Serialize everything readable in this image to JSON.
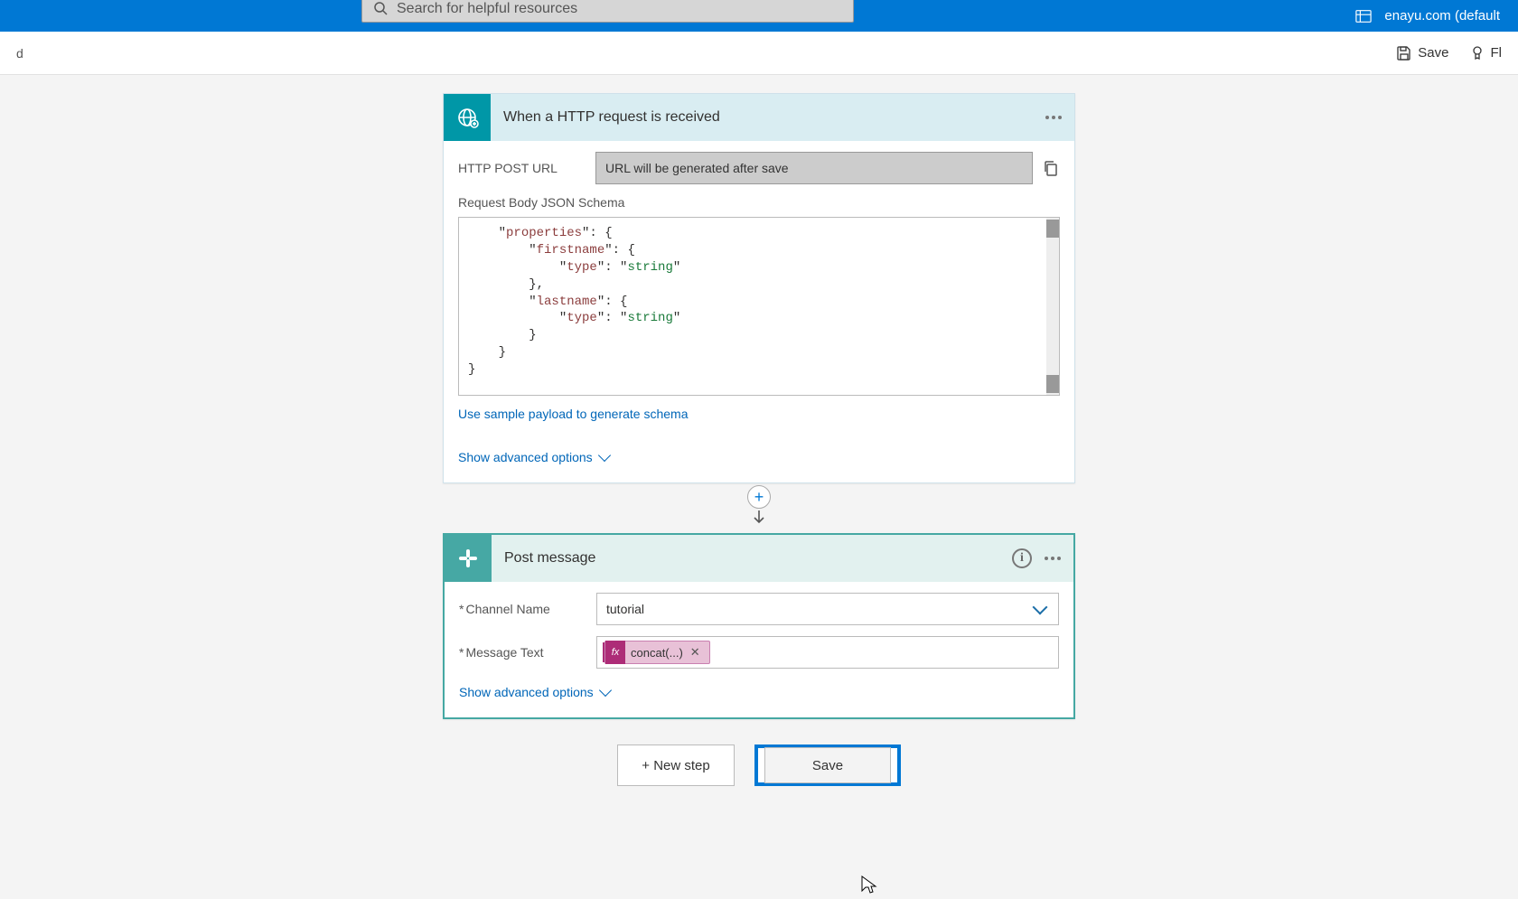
{
  "topbar": {
    "search_placeholder": "Search for helpful resources",
    "tenant": "enayu.com (default"
  },
  "commandbar": {
    "left_frag": "d",
    "save": "Save",
    "flow": "Fl"
  },
  "trigger": {
    "title": "When a HTTP request is received",
    "url_label": "HTTP POST URL",
    "url_value": "URL will be generated after save",
    "schema_label": "Request Body JSON Schema",
    "sample_link": "Use sample payload to generate schema",
    "advanced": "Show advanced options",
    "schema_lines": {
      "l1a": "    \"",
      "l1k": "properties",
      "l1b": "\": {",
      "l2a": "        \"",
      "l2k": "firstname",
      "l2b": "\": {",
      "l3a": "            \"",
      "l3k": "type",
      "l3b": "\": \"",
      "l3s": "string",
      "l3c": "\"",
      "l4": "        },",
      "l5a": "        \"",
      "l5k": "lastname",
      "l5b": "\": {",
      "l6a": "            \"",
      "l6k": "type",
      "l6b": "\": \"",
      "l6s": "string",
      "l6c": "\"",
      "l7": "        }",
      "l8": "    }",
      "l9": "}"
    }
  },
  "action": {
    "title": "Post message",
    "channel_label": "Channel Name",
    "channel_value": "tutorial",
    "message_label": "Message Text",
    "token_fx": "fx",
    "token_text": "concat(...)",
    "advanced": "Show advanced options"
  },
  "footer": {
    "newstep": "+ New step",
    "save": "Save"
  }
}
